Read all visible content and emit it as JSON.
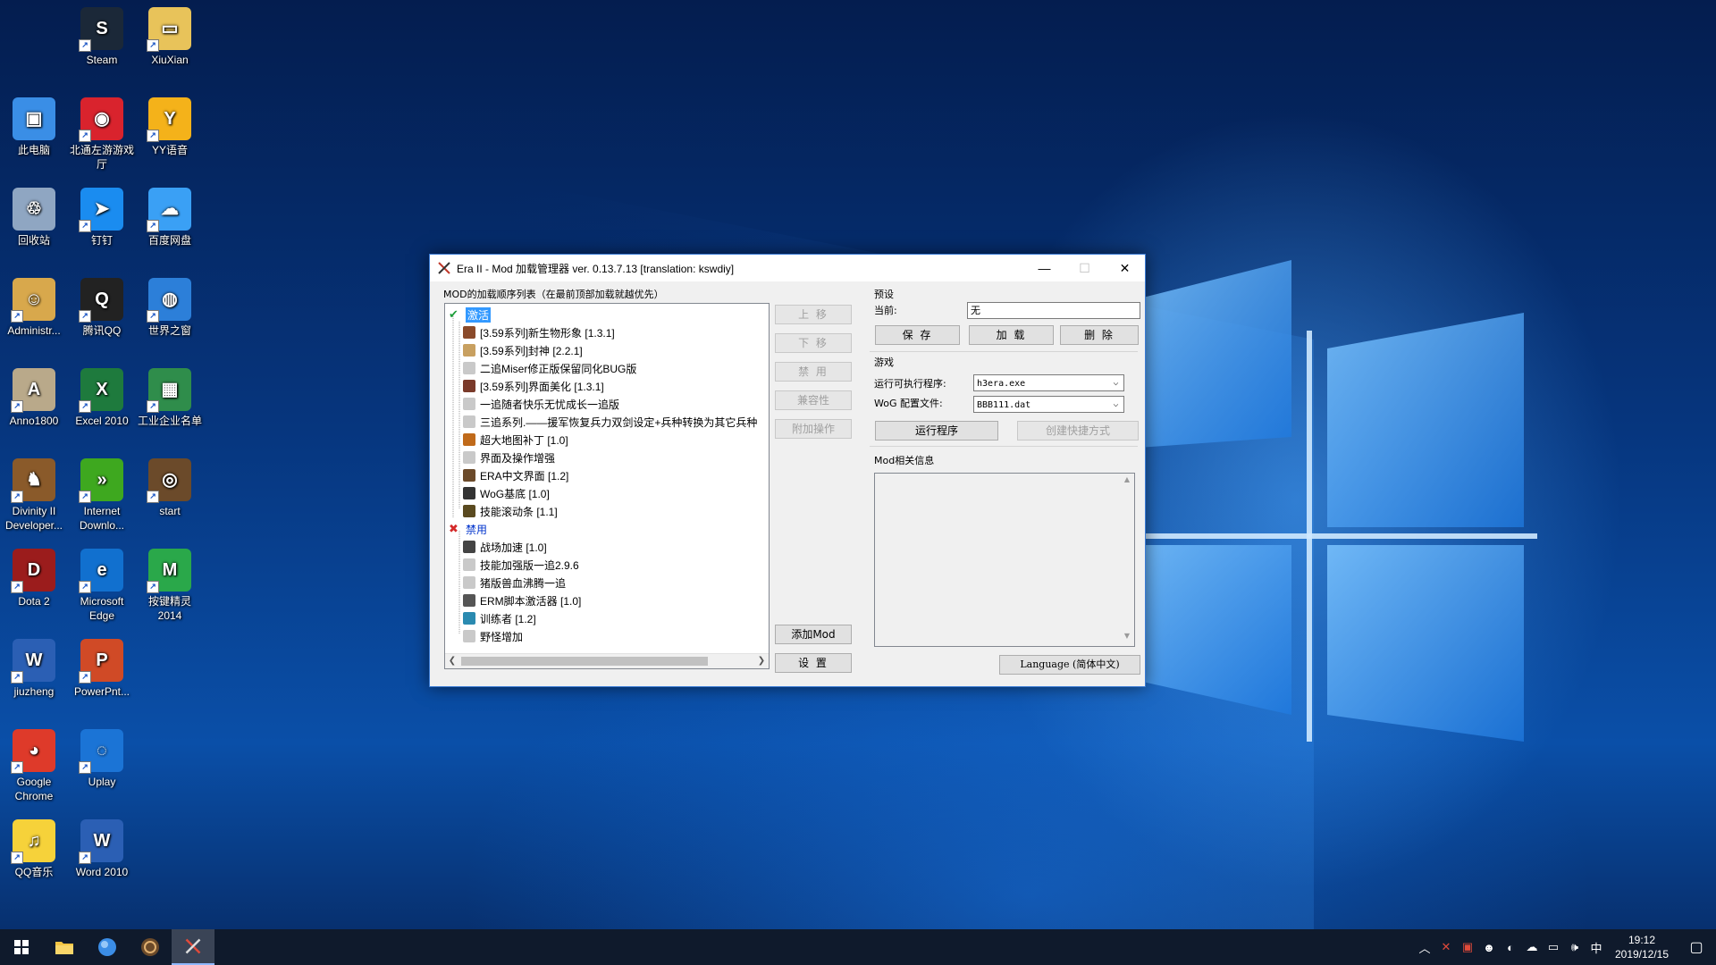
{
  "desktop": {
    "icons": [
      {
        "label": "Steam",
        "color": "#1b2838",
        "glyph": "S"
      },
      {
        "label": "XiuXian",
        "color": "#e8c35a",
        "glyph": "▭"
      },
      {
        "label": "此电脑",
        "color": "#3a8ee6",
        "glyph": "▣"
      },
      {
        "label": "北通左游游戏厅",
        "color": "#d9232d",
        "glyph": "◉"
      },
      {
        "label": "YY语音",
        "color": "#f4b21a",
        "glyph": "Y"
      },
      {
        "label": "回收站",
        "color": "#8fa6c2",
        "glyph": "♲"
      },
      {
        "label": "钉钉",
        "color": "#1a8cf0",
        "glyph": "➤"
      },
      {
        "label": "百度网盘",
        "color": "#3aa0f5",
        "glyph": "☁"
      },
      {
        "label": "Administr...",
        "color": "#d8a84c",
        "glyph": "☺"
      },
      {
        "label": "腾讯QQ",
        "color": "#222222",
        "glyph": "Q"
      },
      {
        "label": "世界之窗",
        "color": "#2c7fd9",
        "glyph": "◍"
      },
      {
        "label": "Anno1800",
        "color": "#b9a98a",
        "glyph": "A"
      },
      {
        "label": "Excel 2010",
        "color": "#1e7a3d",
        "glyph": "X"
      },
      {
        "label": "工业企业名单",
        "color": "#2f8d4b",
        "glyph": "▦"
      },
      {
        "label": "Divinity II Developer...",
        "color": "#8a5a2a",
        "glyph": "♞"
      },
      {
        "label": "Internet Downlo...",
        "color": "#3ea81f",
        "glyph": "»"
      },
      {
        "label": "start",
        "color": "#6b4a2a",
        "glyph": "◎"
      },
      {
        "label": "Dota 2",
        "color": "#9b1c1c",
        "glyph": "D"
      },
      {
        "label": "Microsoft Edge",
        "color": "#1170cf",
        "glyph": "e"
      },
      {
        "label": "按键精灵2014",
        "color": "#2aa84a",
        "glyph": "M"
      },
      {
        "label": "jiuzheng",
        "color": "#2b5fb4",
        "glyph": "W"
      },
      {
        "label": "PowerPnt...",
        "color": "#d04a26",
        "glyph": "P"
      },
      {
        "label": "Google Chrome",
        "color": "#de3a2a",
        "glyph": "◕"
      },
      {
        "label": "Uplay",
        "color": "#1b74d6",
        "glyph": "◌"
      },
      {
        "label": "QQ音乐",
        "color": "#f6d23a",
        "glyph": "♫"
      },
      {
        "label": "Word 2010",
        "color": "#2b5fb4",
        "glyph": "W"
      }
    ]
  },
  "window": {
    "title": "Era II - Mod 加载管理器 ver. 0.13.7.13 [translation: kswdiy]",
    "list_label": "MOD的加载顺序列表（在最前顶部加载就越优先）",
    "active_group": "激活",
    "active_mods": [
      {
        "name": "[3.59系列]新生物形象 [1.3.1]",
        "icon": "portrait-icon",
        "color": "#8a4a2a"
      },
      {
        "name": "[3.59系列]封神 [2.2.1]",
        "icon": "horse-icon",
        "color": "#c8a060"
      },
      {
        "name": "二追Miser修正版保留同化BUG版",
        "icon": "folder-icon",
        "color": "#c9c9c9"
      },
      {
        "name": "[3.59系列]界面美化 [1.3.1]",
        "icon": "portrait-icon",
        "color": "#7a3a2a"
      },
      {
        "name": "一追随者快乐无忧成长一追版",
        "icon": "folder-icon",
        "color": "#c9c9c9"
      },
      {
        "name": "三追系列.——援军恢复兵力双剑设定+兵种转换为其它兵种",
        "icon": "folder-icon",
        "color": "#c9c9c9"
      },
      {
        "name": "超大地图补丁 [1.0]",
        "icon": "map-icon",
        "color": "#c06a1a"
      },
      {
        "name": "界面及操作增强",
        "icon": "folder-icon",
        "color": "#c9c9c9"
      },
      {
        "name": "ERA中文界面 [1.2]",
        "icon": "disc-icon",
        "color": "#6b4a2a"
      },
      {
        "name": "WoG基底 [1.0]",
        "icon": "eye-icon",
        "color": "#333333"
      },
      {
        "name": "技能滚动条 [1.1]",
        "icon": "scroll-icon",
        "color": "#5a4a20"
      }
    ],
    "disabled_group": "禁用",
    "disabled_mods": [
      {
        "name": "战场加速 [1.0]",
        "icon": "runner-icon",
        "color": "#444444"
      },
      {
        "name": "技能加强版一追2.9.6",
        "icon": "folder-icon",
        "color": "#c9c9c9"
      },
      {
        "name": "猪版兽血沸腾一追",
        "icon": "folder-icon",
        "color": "#c9c9c9"
      },
      {
        "name": "ERM脚本激活器 [1.0]",
        "icon": "gear-icon",
        "color": "#555555"
      },
      {
        "name": "训练者 [1.2]",
        "icon": "trainer-icon",
        "color": "#2a8ab0"
      },
      {
        "name": "野怪增加",
        "icon": "folder-icon",
        "color": "#c9c9c9"
      }
    ],
    "buttons": {
      "move_up": "上 移",
      "move_down": "下 移",
      "disable": "禁 用",
      "compat": "兼容性",
      "extra_ops": "附加操作",
      "add_mod": "添加Mod",
      "settings": "设 置"
    },
    "preset": {
      "label": "预设",
      "current_label": "当前:",
      "current_value": "无",
      "save": "保 存",
      "load": "加 载",
      "delete": "删 除"
    },
    "game": {
      "label": "游戏",
      "exe_label": "运行可执行程序:",
      "exe_value": "h3era.exe",
      "wog_label": "WoG 配置文件:",
      "wog_value": "BBB111.dat",
      "run": "运行程序",
      "shortcut": "创建快捷方式"
    },
    "info_label": "Mod相关信息",
    "language_button": "Language (简体中文)"
  },
  "taskbar": {
    "time": "19:12",
    "date": "2019/12/15",
    "ime": "中"
  }
}
